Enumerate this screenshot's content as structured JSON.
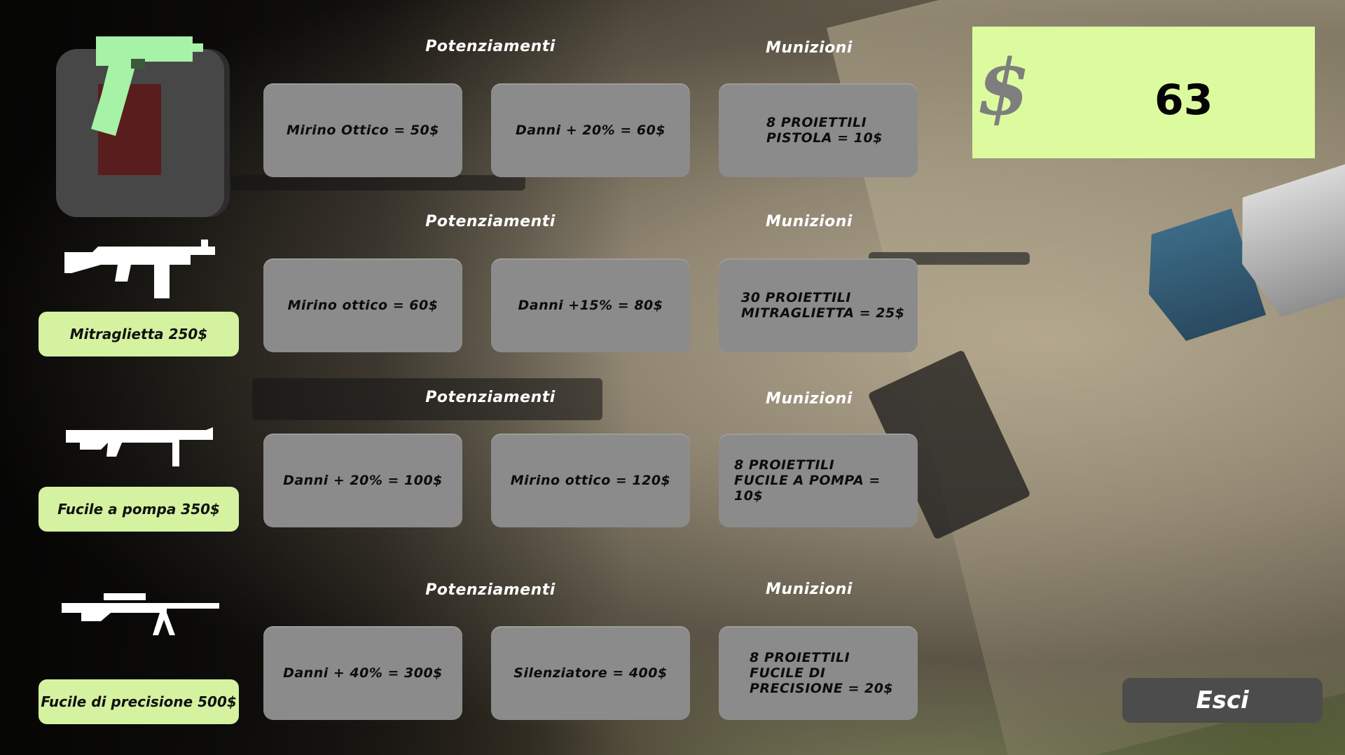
{
  "money": {
    "symbol": "$",
    "amount": "63"
  },
  "exit_label": "Esci",
  "colors": {
    "accent": "#d5f2a0",
    "money_bg": "#dcfb9e",
    "panel": "#8b8b8b",
    "exit": "#4c4c4c",
    "selected_weapon": "#a6f2a6"
  },
  "weapons": [
    {
      "name": "pistol",
      "icon": "pistol-icon",
      "selected": true,
      "upgrades_header": "Potenziamenti",
      "ammo_header": "Munizioni",
      "upgrades": [
        "Mirino Ottico = 50$",
        "Danni + 20% = 60$"
      ],
      "ammo": [
        "8 PROIETTILI",
        "PISTOLA = 10$"
      ]
    },
    {
      "name": "smg",
      "icon": "smg-icon",
      "buy_label": "Mitraglietta 250$",
      "upgrades_header": "Potenziamenti",
      "ammo_header": "Munizioni",
      "upgrades": [
        "Mirino ottico = 60$",
        "Danni +15% = 80$"
      ],
      "ammo": [
        "30 PROIETTILI",
        "MITRAGLIETTA = 25$"
      ]
    },
    {
      "name": "shotgun",
      "icon": "shotgun-icon",
      "buy_label": "Fucile a pompa 350$",
      "upgrades_header": "Potenziamenti",
      "ammo_header": "Munizioni",
      "upgrades": [
        "Danni + 20% = 100$",
        "Mirino ottico = 120$"
      ],
      "ammo": [
        "8 PROIETTILI",
        "FUCILE A POMPA = 10$"
      ]
    },
    {
      "name": "sniper",
      "icon": "sniper-rifle-icon",
      "buy_label": "Fucile di precisione 500$",
      "upgrades_header": "Potenziamenti",
      "ammo_header": "Munizioni",
      "upgrades": [
        "Danni + 40% = 300$",
        "Silenziatore = 400$"
      ],
      "ammo": [
        "8 PROIETTILI",
        "FUCILE DI",
        "PRECISIONE = 20$"
      ]
    }
  ]
}
